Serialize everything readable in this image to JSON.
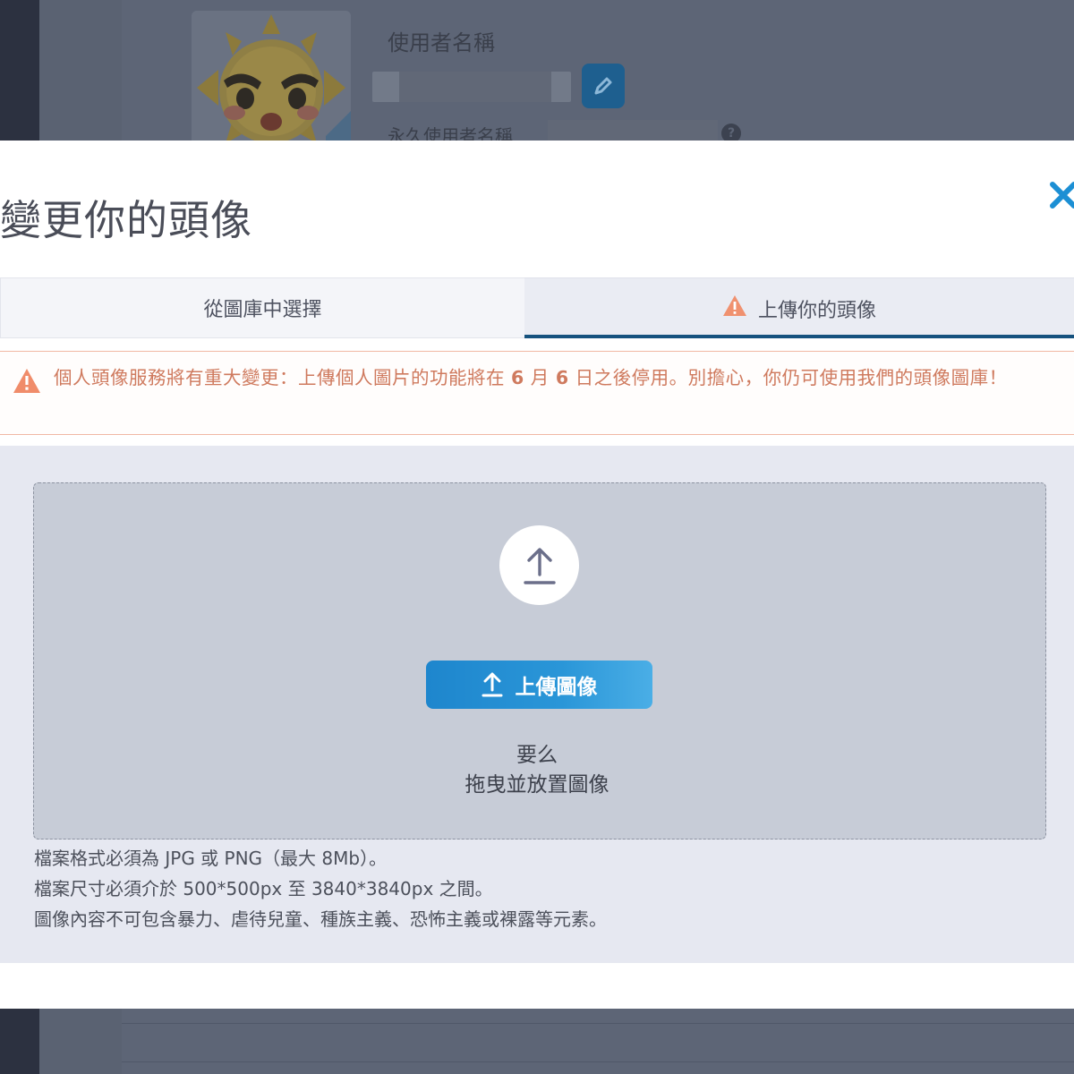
{
  "background": {
    "username_label": "使用者名稱",
    "permanent_username_label": "永久使用者名稱"
  },
  "modal": {
    "title": "變更你的頭像",
    "close_icon": "close-icon",
    "tabs": [
      {
        "label": "從圖庫中選擇",
        "active": false
      },
      {
        "label": "上傳你的頭像",
        "active": true,
        "icon": "warning-icon"
      }
    ],
    "warning": {
      "part1": "個人頭像服務將有重大變更：上傳個人圖片的功能將在 ",
      "month": "6",
      "part2": " 月 ",
      "day": "6",
      "part3": " 日之後停用。別擔心，你仍可使用我們的頭像圖庫！"
    },
    "upload": {
      "button_label": "上傳圖像",
      "or_text": "要么",
      "drag_text": "拖曳並放置圖像",
      "rules": [
        "檔案格式必須為 JPG 或 PNG（最大 8Mb）。",
        "檔案尺寸必須介於 500*500px 至 3840*3840px 之間。",
        "圖像內容不可包含暴力、虐待兒童、種族主義、恐怖主義或裸露等元素。"
      ]
    }
  },
  "colors": {
    "accent": "#1c8fd4",
    "tab_underline": "#16527e",
    "warning": "#e8775a"
  }
}
